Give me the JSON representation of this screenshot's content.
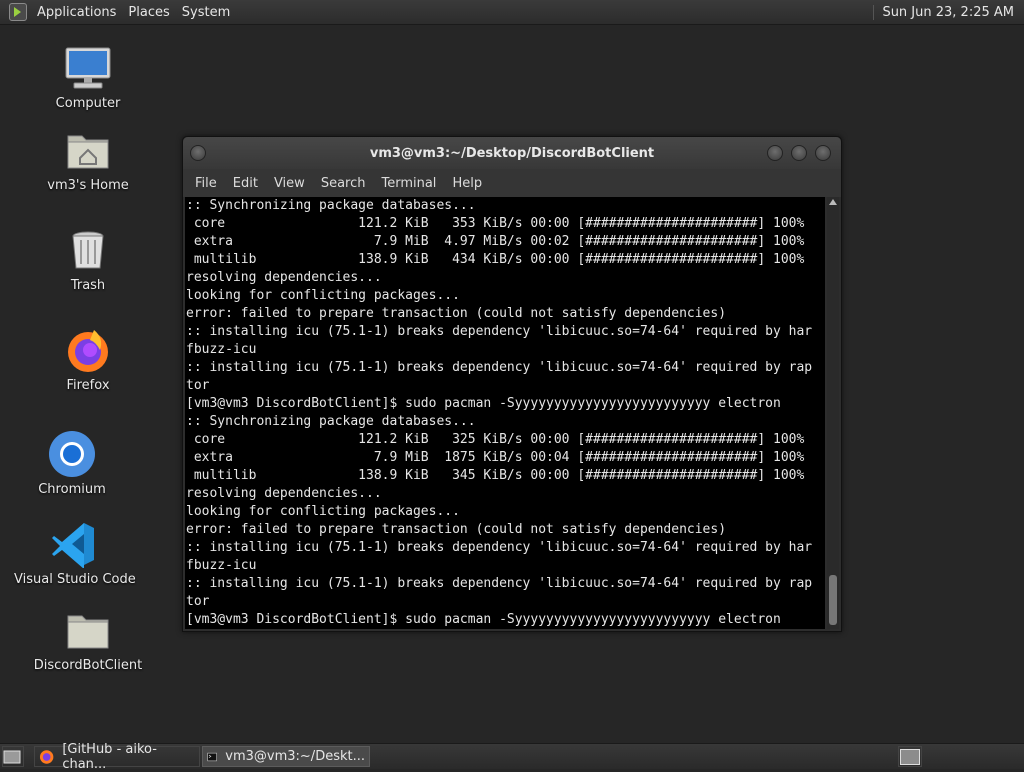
{
  "top_panel": {
    "menus": [
      "Applications",
      "Places",
      "System"
    ],
    "clock": "Sun Jun 23,  2:25 AM"
  },
  "desktop_icons": [
    {
      "label": "Computer",
      "icon": "computer-icon"
    },
    {
      "label": "vm3's Home",
      "icon": "home-folder-icon"
    },
    {
      "label": "Trash",
      "icon": "trash-icon"
    },
    {
      "label": "Firefox",
      "icon": "firefox-icon"
    },
    {
      "label": "Chromium",
      "icon": "chromium-icon"
    },
    {
      "label": "Visual Studio Code",
      "icon": "vscode-icon"
    },
    {
      "label": "DiscordBotClient",
      "icon": "folder-icon"
    }
  ],
  "window": {
    "title": "vm3@vm3:~/Desktop/DiscordBotClient",
    "menu": [
      "File",
      "Edit",
      "View",
      "Search",
      "Terminal",
      "Help"
    ],
    "lines": [
      ":: Synchronizing package databases...",
      " core                 121.2 KiB   353 KiB/s 00:00 [######################] 100%",
      " extra                  7.9 MiB  4.97 MiB/s 00:02 [######################] 100%",
      " multilib             138.9 KiB   434 KiB/s 00:00 [######################] 100%",
      "resolving dependencies...",
      "looking for conflicting packages...",
      "error: failed to prepare transaction (could not satisfy dependencies)",
      ":: installing icu (75.1-1) breaks dependency 'libicuuc.so=74-64' required by har",
      "fbuzz-icu",
      ":: installing icu (75.1-1) breaks dependency 'libicuuc.so=74-64' required by rap",
      "tor",
      "[vm3@vm3 DiscordBotClient]$ sudo pacman -Syyyyyyyyyyyyyyyyyyyyyyyyy electron",
      ":: Synchronizing package databases...",
      " core                 121.2 KiB   325 KiB/s 00:00 [######################] 100%",
      " extra                  7.9 MiB  1875 KiB/s 00:04 [######################] 100%",
      " multilib             138.9 KiB   345 KiB/s 00:00 [######################] 100%",
      "resolving dependencies...",
      "looking for conflicting packages...",
      "error: failed to prepare transaction (could not satisfy dependencies)",
      ":: installing icu (75.1-1) breaks dependency 'libicuuc.so=74-64' required by har",
      "fbuzz-icu",
      ":: installing icu (75.1-1) breaks dependency 'libicuuc.so=74-64' required by rap",
      "tor",
      "[vm3@vm3 DiscordBotClient]$ sudo pacman -Syyyyyyyyyyyyyyyyyyyyyyyyy electron"
    ]
  },
  "taskbar": {
    "tasks": [
      {
        "label": "[GitHub - aiko-chan...",
        "icon": "firefox-icon"
      },
      {
        "label": "vm3@vm3:~/Deskt...",
        "icon": "terminal-icon"
      }
    ]
  }
}
